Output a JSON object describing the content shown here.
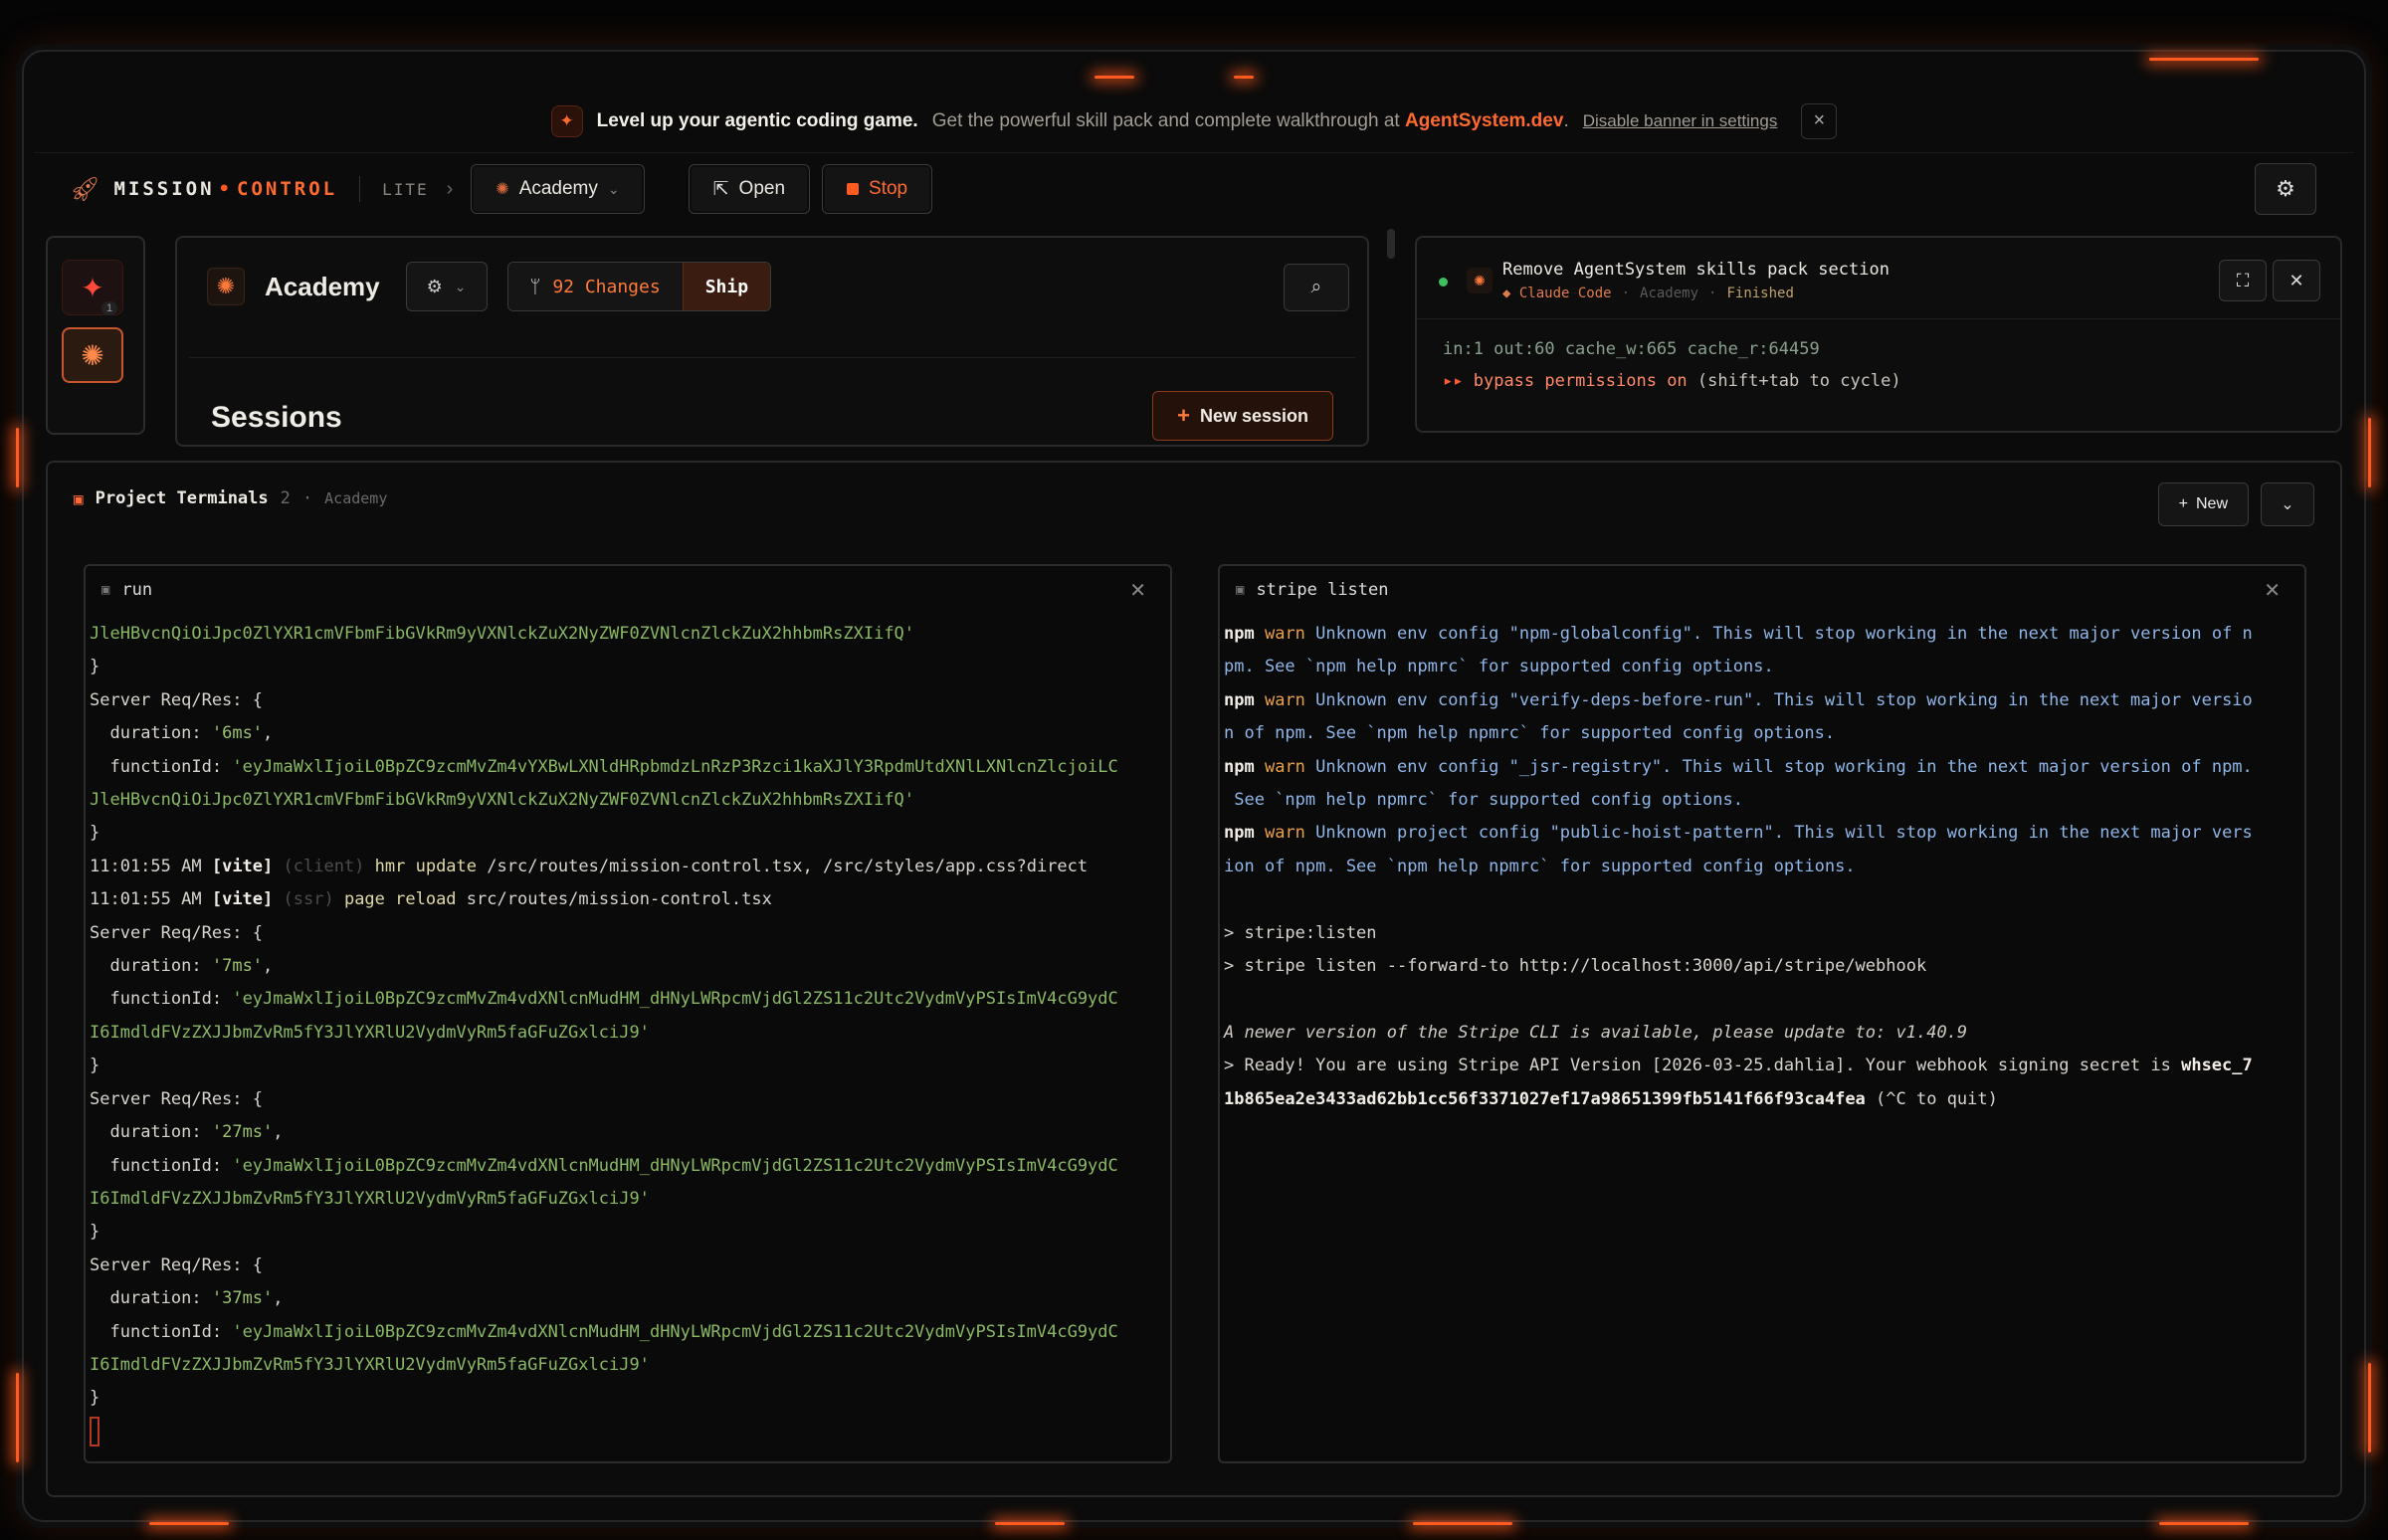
{
  "banner": {
    "headline": "Level up your agentic coding game.",
    "text": "Get the powerful skill pack and complete walkthrough at",
    "link": "AgentSystem.dev",
    "period": ".",
    "disable": "Disable banner in settings",
    "close_icon": "×"
  },
  "topbar": {
    "brand_part1": "MISSION",
    "brand_part2": "CONTROL",
    "tier": "LITE",
    "project": "Academy",
    "open": "Open",
    "stop": "Stop"
  },
  "rail": {
    "badge": "1"
  },
  "academy_panel": {
    "title": "Academy",
    "changes": "92 Changes",
    "ship": "Ship",
    "sessions_title": "Sessions",
    "new_session": "New session"
  },
  "session_card": {
    "title": "Remove AgentSystem skills pack section",
    "agent": "◆ Claude Code",
    "project": "Academy",
    "status": "Finished",
    "stats": "in:1 out:60 cache_w:665 cache_r:64459",
    "bypass_arrows": "▸▸",
    "bypass_text": "bypass permissions on",
    "bypass_hint": "(shift+tab to cycle)"
  },
  "terminals": {
    "title": "Project Terminals",
    "count": "2",
    "project": "Academy",
    "new": "New",
    "left": {
      "tab": "run",
      "jwt_tail": "JleHBvcnQiOiJpc0ZlYXR1cmVFbmFibGVkRm9yVXNlckZuX2NyZWF0ZVNlcnZlckZuX2hhbmRsZXIifQ'",
      "close_brace": "}",
      "req_header": "Server Req/Res: {",
      "duration_key": "duration:",
      "function_key": "functionId:",
      "d1": "'6ms'",
      "fn1_line1": "'eyJmaWxlIjoiL0BpZC9zcmMvZm4vYXBwLXNldHRpbmdzLnRzP3Rzci1kaXJlY3RpdmUtdXNlLXNlcnZlcjoiLC",
      "fn1_line2": "JleHBvcnQiOiJpc0ZlYXR1cmVFbmFibGVkRm9yVXNlckZuX2NyZWF0ZVNlcnZlckZuX2hhbmRsZXIifQ'",
      "time": "11:01:55 AM",
      "vite": "[vite]",
      "client": "(client)",
      "ssr": "(ssr)",
      "hmr": "hmr update",
      "hmr_paths": "/src/routes/mission-control.tsx, /src/styles/app.css?direct",
      "reload": "page reload",
      "reload_path": "src/routes/mission-control.tsx",
      "d2": "'7ms'",
      "d3": "'27ms'",
      "d4": "'37ms'",
      "fn2_line1": "'eyJmaWxlIjoiL0BpZC9zcmMvZm4vdXNlcnMudHM_dHNyLWRpcmVjdGl2ZS11c2Utc2VydmVyPSIsImV4cG9ydC",
      "fn2_line2": "I6ImdldFVzZXJJbmZvRm5fY3JlYXRlU2VydmVyRm5faGFuZGxlciJ9'",
      "fn3_line1": "'eyJmaWxlIjoiL0BpZC9zcmMvZm4vdXNlcnMudHM_dHNyLWRpcmVjdGl2ZS11c2Utc2VydmVyPSIsImV4cG9ydC",
      "fn3_line2": "I6ImdldFVzZXJJbmZvRm5fY3JlYXRlU2VydmVyRm5faGFuZGxlciJ9'",
      "fn4_line1": "'eyJmaWxlIjoiL0BpZC9zcmMvZm4vdXNlcnMudHM_dHNyLWRpcmVjdGl2ZS11c2Utc2VydmVyPSIsImV4cG9ydC",
      "fn4_line2": "I6ImdldFVzZXJJbmZvRm5fY3JlYXRlU2VydmVyRm5faGFuZGxlciJ9'"
    },
    "right": {
      "tab": "stripe listen",
      "npm": "npm",
      "warn": "warn",
      "w1a": "Unknown env config \"npm-globalconfig\". This will stop working in the next major version of n",
      "w1b": "pm. See `npm help npmrc` for supported config options.",
      "w2a": "Unknown env config \"verify-deps-before-run\". This will stop working in the next major versio",
      "w2b": "n of npm. See `npm help npmrc` for supported config options.",
      "w3a": "Unknown env config \"_jsr-registry\". This will stop working in the next major version of npm.",
      "w3b": " See `npm help npmrc` for supported config options.",
      "w4a": "Unknown project config \"public-hoist-pattern\". This will stop working in the next major vers",
      "w4b": "ion of npm. See `npm help npmrc` for supported config options.",
      "cmd1": "> stripe:listen",
      "cmd2": "> stripe listen --forward-to http://localhost:3000/api/stripe/webhook",
      "newer": "A newer version of the Stripe CLI is available, please update to: v1.40.9",
      "ready": "> Ready! You are using Stripe API Version [2026-03-25.dahlia]. Your webhook signing secret is",
      "secret_a": "whsec_7",
      "secret_b": "1b865ea2e3433ad62bb1cc56f3371027ef17a98651399fb5141f66f93ca4fea",
      "quit": "(^C to quit)"
    }
  },
  "colors": {
    "accent": "#ff5a1f",
    "accent_text": "#ff6a30",
    "background": "#0b0b0b",
    "terminal_string": "#8ab865",
    "npm_warn": "#e9a048",
    "status_dot": "#3cc060"
  },
  "icons": {
    "banner": "sparkle-icon",
    "logo": "rocket-icon",
    "settings": "gear-icon",
    "search": "search-icon",
    "branch": "git-branch-icon",
    "terminal": "terminal-icon",
    "expand": "expand-icon",
    "close": "close-icon"
  }
}
